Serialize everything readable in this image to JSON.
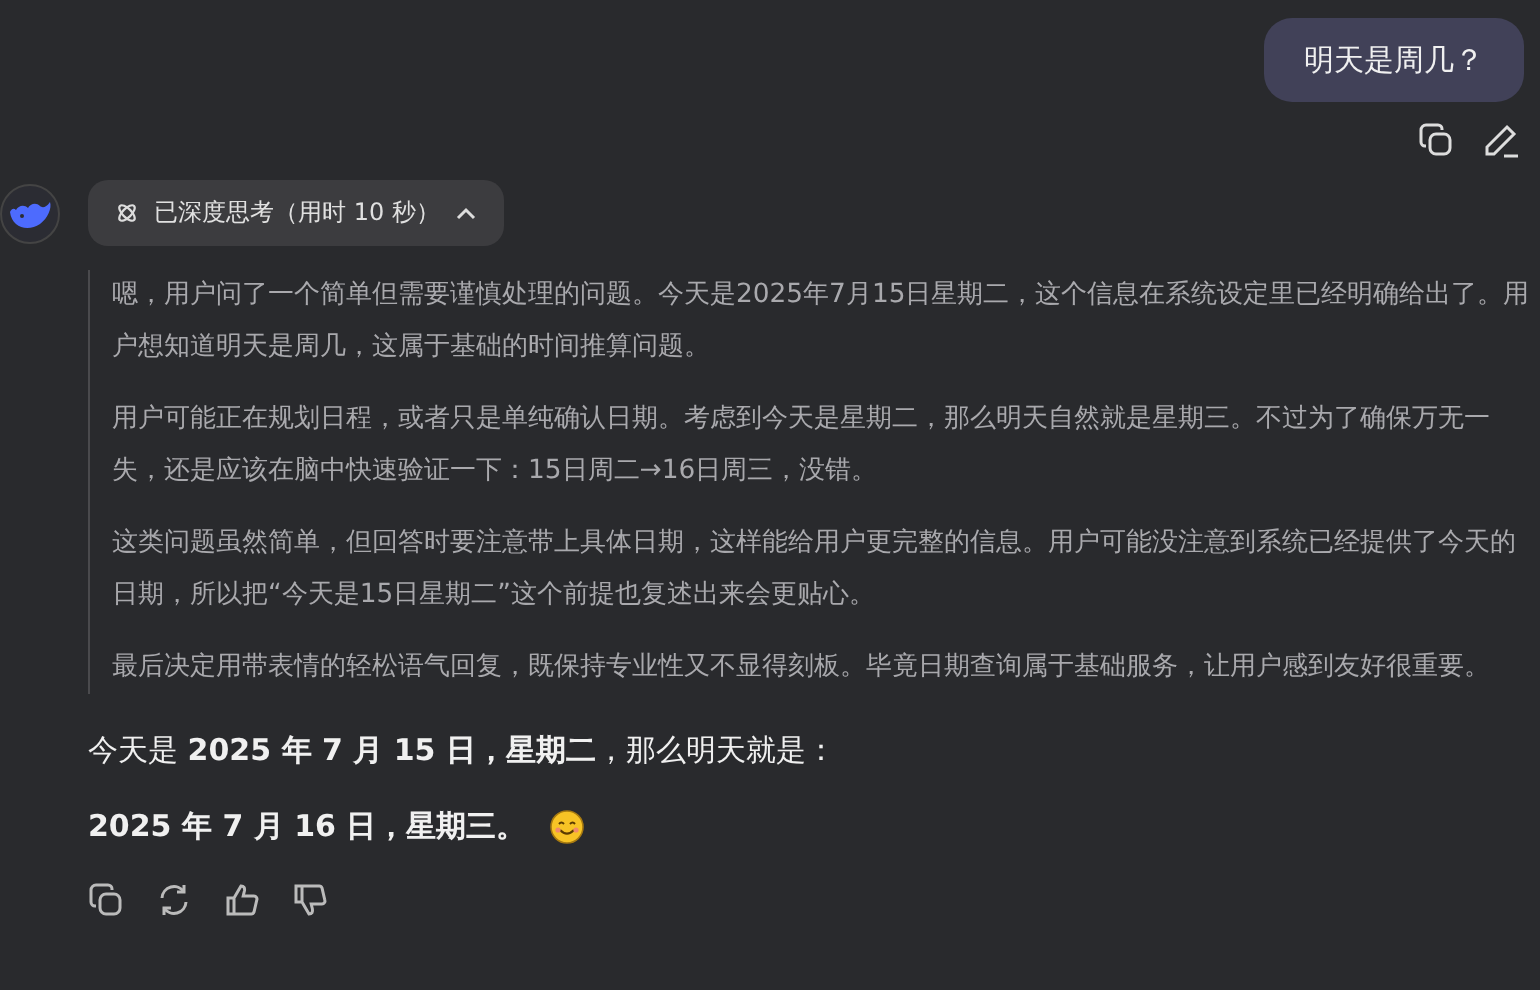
{
  "user_message": {
    "text": "明天是周几？"
  },
  "thinking": {
    "label": "已深度思考（用时 10 秒）",
    "expanded": true,
    "paragraphs": [
      "嗯，用户问了一个简单但需要谨慎处理的问题。今天是2025年7月15日星期二，这个信息在系统设定里已经明确给出了。用户想知道明天是周几，这属于基础的时间推算问题。",
      "用户可能正在规划日程，或者只是单纯确认日期。考虑到今天是星期二，那么明天自然就是星期三。不过为了确保万无一失，还是应该在脑中快速验证一下：15日周二→16日周三，没错。",
      "这类问题虽然简单，但回答时要注意带上具体日期，这样能给用户更完整的信息。用户可能没注意到系统已经提供了今天的日期，所以把“今天是15日星期二”这个前提也复述出来会更贴心。",
      "最后决定用带表情的轻松语气回复，既保持专业性又不显得刻板。毕竟日期查询属于基础服务，让用户感到友好很重要。"
    ]
  },
  "answer": {
    "line_1": "今天是 **2025 年 7 月 15 日，星期二**，那么明天就是：",
    "line_2": "2025 年 7 月 16 日，星期三。"
  }
}
